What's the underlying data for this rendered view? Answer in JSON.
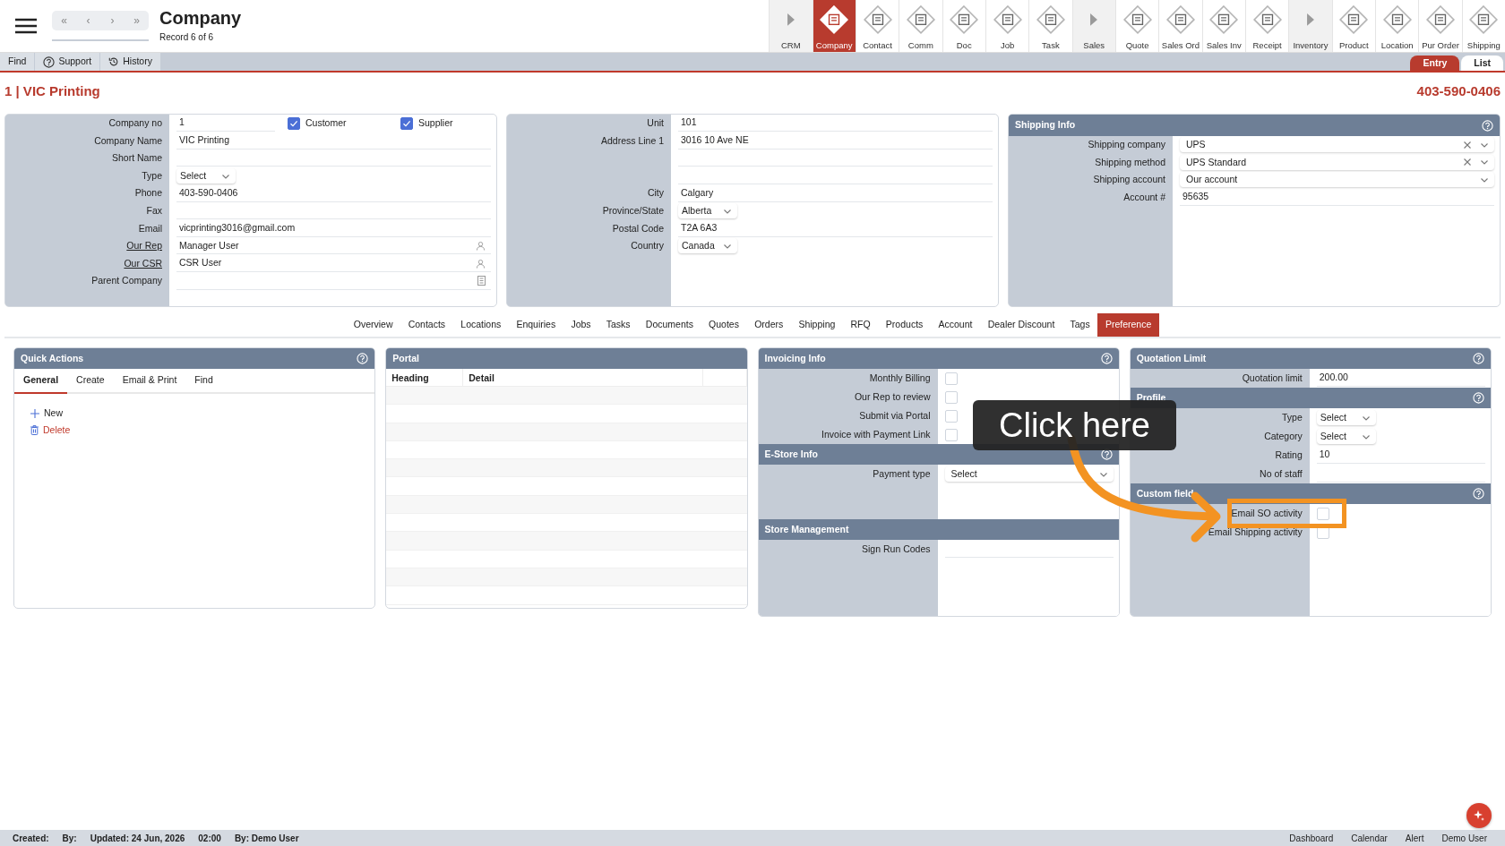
{
  "header": {
    "nav_buttons": [
      "«",
      "‹",
      "›",
      "»"
    ],
    "title": "Company",
    "subtitle": "Record 6 of 6"
  },
  "modules": [
    {
      "label": "CRM",
      "kind": "section",
      "selected": false
    },
    {
      "label": "Company",
      "kind": "module",
      "selected": true
    },
    {
      "label": "Contact",
      "kind": "module",
      "selected": false
    },
    {
      "label": "Comm",
      "kind": "module",
      "selected": false
    },
    {
      "label": "Doc",
      "kind": "module",
      "selected": false
    },
    {
      "label": "Job",
      "kind": "module",
      "selected": false
    },
    {
      "label": "Task",
      "kind": "module",
      "selected": false
    },
    {
      "label": "Sales",
      "kind": "section",
      "selected": false
    },
    {
      "label": "Quote",
      "kind": "module",
      "selected": false
    },
    {
      "label": "Sales Ord",
      "kind": "module",
      "selected": false
    },
    {
      "label": "Sales Inv",
      "kind": "module",
      "selected": false
    },
    {
      "label": "Receipt",
      "kind": "module",
      "selected": false
    },
    {
      "label": "Inventory",
      "kind": "section",
      "selected": false
    },
    {
      "label": "Product",
      "kind": "module",
      "selected": false
    },
    {
      "label": "Location",
      "kind": "module",
      "selected": false
    },
    {
      "label": "Pur Order",
      "kind": "module",
      "selected": false
    },
    {
      "label": "Shipping",
      "kind": "module",
      "selected": false
    }
  ],
  "toolbar": {
    "actions": [
      {
        "label": "Find",
        "kind": "plain"
      },
      {
        "label": "Support",
        "kind": "help"
      },
      {
        "label": "History",
        "kind": "history"
      }
    ],
    "views": [
      {
        "label": "Entry",
        "selected": true
      },
      {
        "label": "List",
        "selected": false
      }
    ]
  },
  "record": {
    "title": "1 | VIC Printing",
    "phone": "403-590-0406"
  },
  "company_panel": {
    "rows": [
      {
        "label": "Company no",
        "kind": "flags",
        "value": "1",
        "checks": [
          {
            "label": "Customer",
            "checked": true
          },
          {
            "label": "Supplier",
            "checked": true
          }
        ]
      },
      {
        "label": "Company Name",
        "kind": "text",
        "value": "VIC Printing"
      },
      {
        "label": "Short Name",
        "kind": "text"
      },
      {
        "label": "Type",
        "kind": "select",
        "value": "Select"
      },
      {
        "label": "Phone",
        "kind": "text",
        "value": "403-590-0406"
      },
      {
        "label": "Fax",
        "kind": "text"
      },
      {
        "label": "Email",
        "kind": "text",
        "value": "vicprinting3016@gmail.com"
      },
      {
        "label": "Our Rep",
        "link": true,
        "kind": "person",
        "value": "Manager User"
      },
      {
        "label": "Our CSR",
        "link": true,
        "kind": "person",
        "value": "CSR User"
      },
      {
        "label": "Parent Company",
        "kind": "record"
      }
    ]
  },
  "address_panel": {
    "rows": [
      {
        "label": "Unit",
        "kind": "text",
        "value": "101"
      },
      {
        "label": "Address Line 1",
        "kind": "text",
        "value": "3016 10 Ave NE"
      },
      {
        "kind": "text"
      },
      {
        "kind": "text"
      },
      {
        "label": "City",
        "kind": "text",
        "value": "Calgary"
      },
      {
        "label": "Province/State",
        "kind": "select",
        "value": "Alberta"
      },
      {
        "label": "Postal Code",
        "kind": "text",
        "value": "T2A 6A3"
      },
      {
        "label": "Country",
        "kind": "select",
        "value": "Canada"
      }
    ]
  },
  "shipping_panel": {
    "title": "Shipping Info",
    "help": true,
    "rows": [
      {
        "label": "Shipping company",
        "kind": "combo",
        "value": "UPS",
        "clearable": true
      },
      {
        "label": "Shipping method",
        "kind": "combo",
        "value": "UPS Standard",
        "clearable": true
      },
      {
        "label": "Shipping account",
        "kind": "combo",
        "value": "Our account",
        "clearable": false
      },
      {
        "label": "Account #",
        "kind": "text",
        "value": "95635"
      }
    ]
  },
  "record_tabs": [
    {
      "label": "Overview",
      "selected": false
    },
    {
      "label": "Contacts",
      "selected": false
    },
    {
      "label": "Locations",
      "selected": false
    },
    {
      "label": "Enquiries",
      "selected": false
    },
    {
      "label": "Jobs",
      "selected": false
    },
    {
      "label": "Tasks",
      "selected": false
    },
    {
      "label": "Documents",
      "selected": false
    },
    {
      "label": "Quotes",
      "selected": false
    },
    {
      "label": "Orders",
      "selected": false
    },
    {
      "label": "Shipping",
      "selected": false
    },
    {
      "label": "RFQ",
      "selected": false
    },
    {
      "label": "Products",
      "selected": false
    },
    {
      "label": "Account",
      "selected": false
    },
    {
      "label": "Dealer Discount",
      "selected": false
    },
    {
      "label": "Tags",
      "selected": false
    },
    {
      "label": "Preference",
      "selected": true
    }
  ],
  "quick_actions": {
    "title": "Quick Actions",
    "help": true,
    "tabs": [
      {
        "label": "General",
        "selected": true
      },
      {
        "label": "Create",
        "selected": false
      },
      {
        "label": "Email & Print",
        "selected": false
      },
      {
        "label": "Find",
        "selected": false
      }
    ],
    "actions": [
      {
        "label": "New",
        "kind": "new"
      },
      {
        "label": "Delete",
        "kind": "delete"
      }
    ]
  },
  "portal": {
    "title": "Portal",
    "columns": [
      "Heading",
      "Detail"
    ]
  },
  "middle_sections": [
    {
      "title": "Invoicing Info",
      "help": true,
      "rows": [
        {
          "label": "Monthly Billing",
          "kind": "check",
          "checked": false
        },
        {
          "label": "Our Rep to review",
          "kind": "check",
          "checked": false
        },
        {
          "label": "Submit via Portal",
          "kind": "check",
          "checked": false
        },
        {
          "label": "Invoice with Payment Link",
          "kind": "check",
          "checked": false
        }
      ]
    },
    {
      "title": "E-Store Info",
      "help": true,
      "rows": [
        {
          "label": "Payment type",
          "kind": "combo",
          "value": "Select",
          "clearable": false
        }
      ]
    },
    {
      "title": "Store Management",
      "help": false,
      "rows": [
        {
          "label": "Sign Run Codes",
          "kind": "text"
        }
      ]
    }
  ],
  "right_sections": [
    {
      "title": "Quotation Limit",
      "help": true,
      "rows": [
        {
          "label": "Quotation limit",
          "kind": "text",
          "value": "200.00"
        }
      ]
    },
    {
      "title": "Profile",
      "help": true,
      "rows": [
        {
          "label": "Type",
          "kind": "select",
          "value": "Select"
        },
        {
          "label": "Category",
          "kind": "select",
          "value": "Select"
        },
        {
          "label": "Rating",
          "kind": "text",
          "value": "10"
        },
        {
          "label": "No of staff",
          "kind": "text"
        }
      ]
    },
    {
      "title": "Custom field",
      "help": true,
      "rows": [
        {
          "label": "Email SO activity",
          "kind": "check",
          "checked": false
        },
        {
          "label": "Email Shipping activity",
          "kind": "check",
          "checked": false
        }
      ]
    }
  ],
  "callout": {
    "text": "Click here"
  },
  "status_bar": {
    "left": [
      "Created:",
      "By:",
      "Updated: 24 Jun, 2026",
      "02:00",
      "By: Demo User"
    ],
    "right": [
      "Dashboard",
      "Calendar",
      "Alert",
      "Demo User"
    ]
  }
}
